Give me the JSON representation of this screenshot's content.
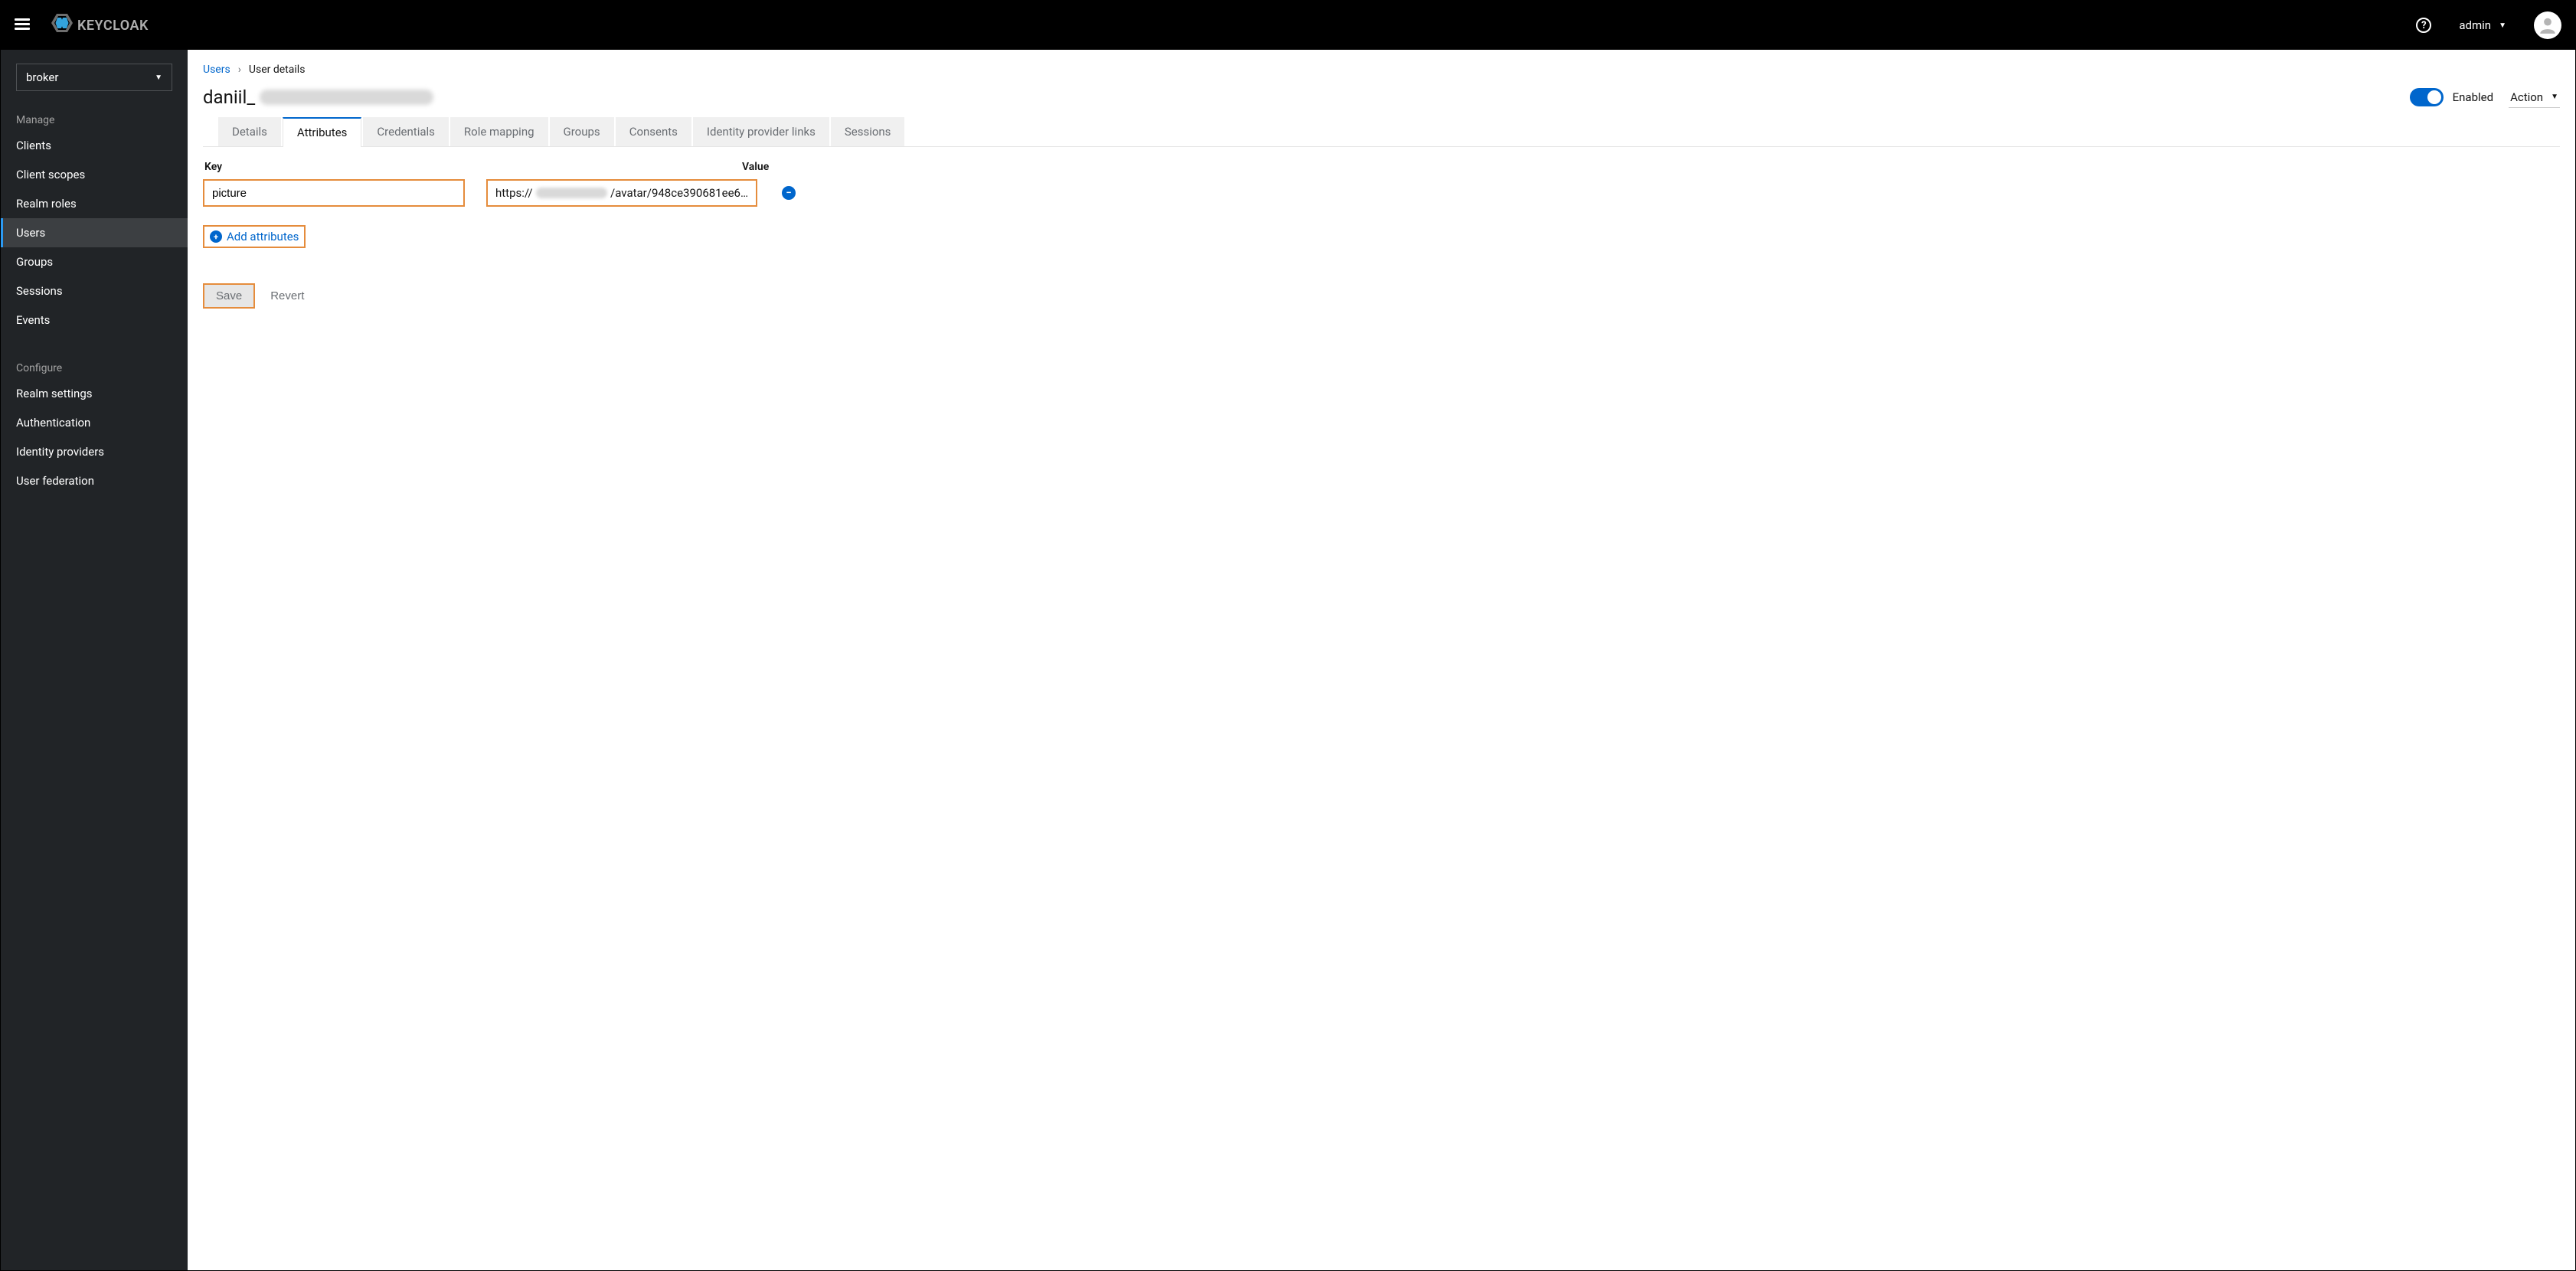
{
  "topbar": {
    "logo_text": "KEYCLOAK",
    "user_name": "admin"
  },
  "sidebar": {
    "realm_selected": "broker",
    "manage_label": "Manage",
    "manage_items": [
      "Clients",
      "Client scopes",
      "Realm roles",
      "Users",
      "Groups",
      "Sessions",
      "Events"
    ],
    "manage_active_index": 3,
    "configure_label": "Configure",
    "configure_items": [
      "Realm settings",
      "Authentication",
      "Identity providers",
      "User federation"
    ]
  },
  "breadcrumb": {
    "parent": "Users",
    "current": "User details"
  },
  "page": {
    "title_prefix": "daniil_",
    "enabled_label": "Enabled",
    "action_label": "Action"
  },
  "tabs": {
    "items": [
      "Details",
      "Attributes",
      "Credentials",
      "Role mapping",
      "Groups",
      "Consents",
      "Identity provider links",
      "Sessions"
    ],
    "active_index": 1
  },
  "attributes": {
    "key_header": "Key",
    "value_header": "Value",
    "row": {
      "key": "picture",
      "value_prefix": "https://",
      "value_suffix": "/avatar/948ce390681ee6…"
    },
    "add_label": "Add attributes",
    "save_label": "Save",
    "revert_label": "Revert"
  }
}
